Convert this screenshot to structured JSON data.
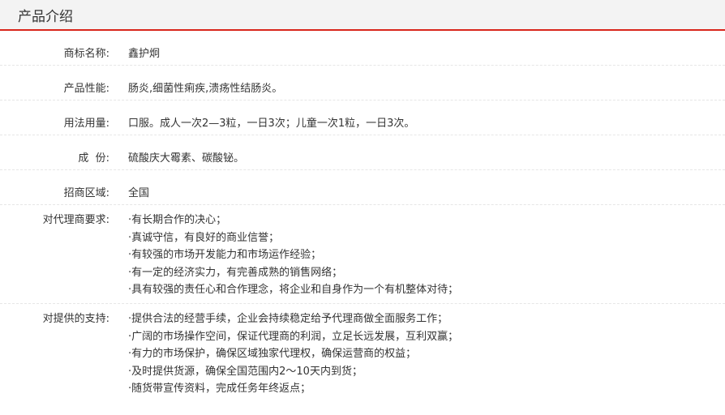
{
  "header": {
    "title": "产品介绍"
  },
  "rows": [
    {
      "label": "商标名称:",
      "value": "鑫护炯"
    },
    {
      "label": "产品性能:",
      "value": "肠炎,细菌性痢疾,溃疡性结肠炎。"
    },
    {
      "label": "用法用量:",
      "value": "口服。成人一次2—3粒，一日3次；儿童一次1粒，一日3次。"
    },
    {
      "label": "成  份:",
      "value": "硫酸庆大霉素、碳酸铋。"
    },
    {
      "label": "招商区域:",
      "value": "全国"
    }
  ],
  "agent_requirements": {
    "label": "对代理商要求:",
    "lines": [
      "·有长期合作的决心；",
      "·真诚守信，有良好的商业信誉；",
      "·有较强的市场开发能力和市场运作经验；",
      "·有一定的经济实力，有完善成熟的销售网络；",
      "·具有较强的责任心和合作理念，将企业和自身作为一个有机整体对待；"
    ]
  },
  "support": {
    "label": "对提供的支持:",
    "lines": [
      "·提供合法的经营手续，企业会持续稳定给予代理商做全面服务工作；",
      "·广阔的市场操作空间，保证代理商的利润，立足长远发展，互利双赢；",
      "·有力的市场保护，确保区域独家代理权，确保运营商的权益；",
      "·及时提供货源，确保全国范围内2～10天内到货；",
      "·随货带宣传资料，完成任务年终返点；"
    ]
  }
}
